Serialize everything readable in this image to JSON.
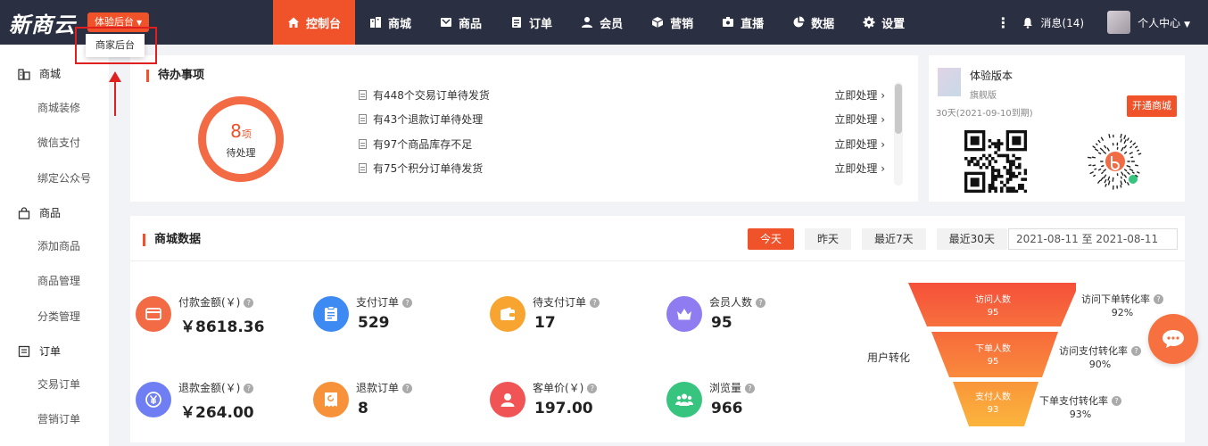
{
  "app": {
    "logo": "新商云",
    "version_switch": "体验后台",
    "dropdown_item": "商家后台"
  },
  "nav": [
    {
      "label": "控制台",
      "icon": "home-icon",
      "active": true
    },
    {
      "label": "商城",
      "icon": "store-icon",
      "active": false
    },
    {
      "label": "商品",
      "icon": "product-icon",
      "active": false
    },
    {
      "label": "订单",
      "icon": "order-icon",
      "active": false
    },
    {
      "label": "会员",
      "icon": "member-icon",
      "active": false
    },
    {
      "label": "营销",
      "icon": "marketing-icon",
      "active": false
    },
    {
      "label": "直播",
      "icon": "live-icon",
      "active": false
    },
    {
      "label": "数据",
      "icon": "data-icon",
      "active": false
    },
    {
      "label": "设置",
      "icon": "settings-icon",
      "active": false
    }
  ],
  "header_right": {
    "messages": "消息(14)",
    "user_center": "个人中心"
  },
  "sidebar": {
    "groups": [
      {
        "label": "商城",
        "icon": "store-icon",
        "items": [
          "商城装修",
          "微信支付",
          "绑定公众号"
        ]
      },
      {
        "label": "商品",
        "icon": "bag-icon",
        "items": [
          "添加商品",
          "商品管理",
          "分类管理"
        ]
      },
      {
        "label": "订单",
        "icon": "order-list-icon",
        "items": [
          "交易订单",
          "营销订单"
        ]
      }
    ]
  },
  "todo": {
    "title": "待办事项",
    "count": "8",
    "count_unit": "项",
    "count_label": "待处理",
    "items": [
      {
        "text": "有448个交易订单待发货",
        "action": "立即处理 ›"
      },
      {
        "text": "有43个退款订单待处理",
        "action": "立即处理 ›"
      },
      {
        "text": "有97个商品库存不足",
        "action": "立即处理 ›"
      },
      {
        "text": "有75个积分订单待发货",
        "action": "立即处理 ›"
      }
    ]
  },
  "version": {
    "name": "体验版本",
    "tier": "旗舰版",
    "days": "30天(2021-09-10到期)",
    "open_button": "开通商城"
  },
  "mall_data": {
    "title": "商城数据",
    "tabs": [
      {
        "label": "今天",
        "active": true
      },
      {
        "label": "昨天",
        "active": false
      },
      {
        "label": "最近7天",
        "active": false
      },
      {
        "label": "最近30天",
        "active": false
      }
    ],
    "date_range": "2021-08-11 至 2021-08-11",
    "metrics": [
      {
        "label": "付款金额(￥)",
        "value": "￥8618.36",
        "color": "#f36b45",
        "icon": "card-icon"
      },
      {
        "label": "支付订单",
        "value": "529",
        "color": "#3d8bf2",
        "icon": "clipboard-icon"
      },
      {
        "label": "待支付订单",
        "value": "17",
        "color": "#f7a530",
        "icon": "wallet-icon"
      },
      {
        "label": "会员人数",
        "value": "95",
        "color": "#8e7cf0",
        "icon": "crown-icon"
      },
      {
        "label": "退款金额(￥)",
        "value": "￥264.00",
        "color": "#6f7ff3",
        "icon": "yen-icon"
      },
      {
        "label": "退款订单",
        "value": "8",
        "color": "#f7913a",
        "icon": "refund-icon"
      },
      {
        "label": "客单价(￥)",
        "value": "197.00",
        "color": "#f05454",
        "icon": "user-icon"
      },
      {
        "label": "浏览量",
        "value": "966",
        "color": "#36c47e",
        "icon": "group-icon"
      }
    ],
    "funnel": {
      "title": "用户转化",
      "stages": [
        {
          "label": "访问人数",
          "value": "95"
        },
        {
          "label": "下单人数",
          "value": "95"
        },
        {
          "label": "支付人数",
          "value": "93"
        }
      ],
      "rates": [
        {
          "label": "访问下单转化率",
          "value": "92%"
        },
        {
          "label": "访问支付转化率",
          "value": "90%"
        },
        {
          "label": "下单支付转化率",
          "value": "93%"
        }
      ]
    }
  },
  "colors": {
    "accent": "#f0522a",
    "topbar": "#2b2f42"
  }
}
